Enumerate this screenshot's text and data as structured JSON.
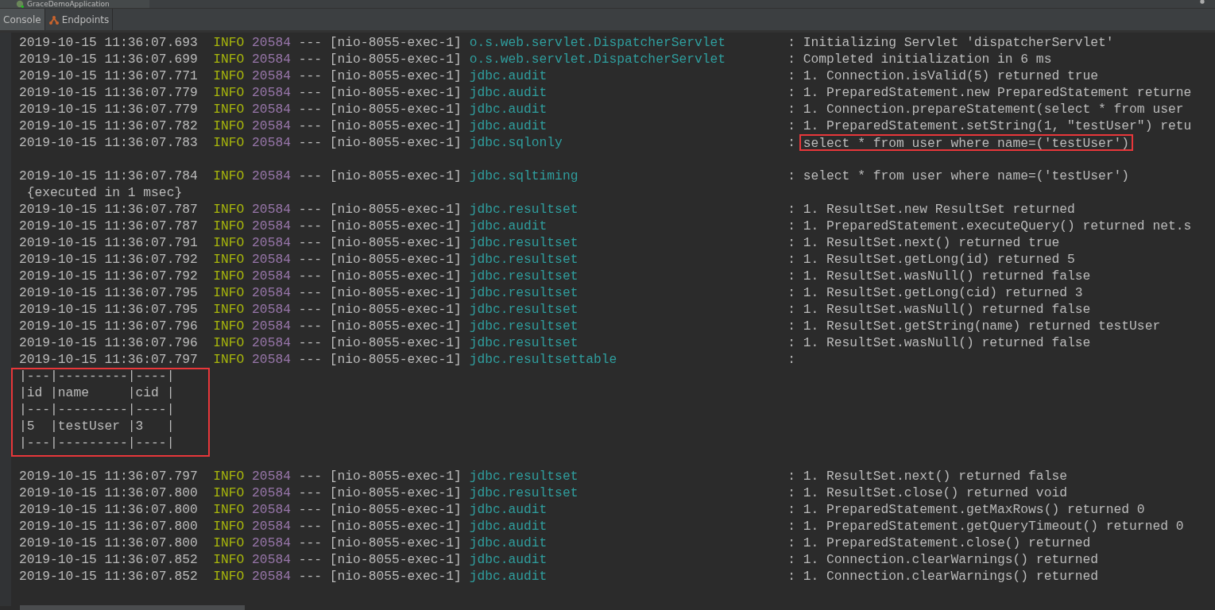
{
  "window": {
    "title": "GraceDemoApplication"
  },
  "tabs": [
    {
      "label": "Console",
      "selected": true
    },
    {
      "label": "Endpoints",
      "selected": false
    }
  ],
  "rows": [
    {
      "kind": "log",
      "time": "2019-10-15 11:36:07.693",
      "level": "INFO",
      "pid": "20584",
      "dashes": "---",
      "thread": "[nio-8055-exec-1]",
      "logger": "o.s.web.servlet.DispatcherServlet",
      "sep": ":",
      "message": "Initializing Servlet 'dispatcherServlet'"
    },
    {
      "kind": "log",
      "time": "2019-10-15 11:36:07.699",
      "level": "INFO",
      "pid": "20584",
      "dashes": "---",
      "thread": "[nio-8055-exec-1]",
      "logger": "o.s.web.servlet.DispatcherServlet",
      "sep": ":",
      "message": "Completed initialization in 6 ms"
    },
    {
      "kind": "log",
      "time": "2019-10-15 11:36:07.771",
      "level": "INFO",
      "pid": "20584",
      "dashes": "---",
      "thread": "[nio-8055-exec-1]",
      "logger": "jdbc.audit",
      "sep": ":",
      "message": "1. Connection.isValid(5) returned true"
    },
    {
      "kind": "log",
      "time": "2019-10-15 11:36:07.779",
      "level": "INFO",
      "pid": "20584",
      "dashes": "---",
      "thread": "[nio-8055-exec-1]",
      "logger": "jdbc.audit",
      "sep": ":",
      "message": "1. PreparedStatement.new PreparedStatement returne"
    },
    {
      "kind": "log",
      "time": "2019-10-15 11:36:07.779",
      "level": "INFO",
      "pid": "20584",
      "dashes": "---",
      "thread": "[nio-8055-exec-1]",
      "logger": "jdbc.audit",
      "sep": ":",
      "message": "1. Connection.prepareStatement(select * from user"
    },
    {
      "kind": "log",
      "time": "2019-10-15 11:36:07.782",
      "level": "INFO",
      "pid": "20584",
      "dashes": "---",
      "thread": "[nio-8055-exec-1]",
      "logger": "jdbc.audit",
      "sep": ":",
      "message": "1. PreparedStatement.setString(1, \"testUser\") retu"
    },
    {
      "kind": "log",
      "time": "2019-10-15 11:36:07.783",
      "level": "INFO",
      "pid": "20584",
      "dashes": "---",
      "thread": "[nio-8055-exec-1]",
      "logger": "jdbc.sqlonly",
      "sep": ":",
      "message": "select * from user where name=('testUser')",
      "highlighted": true
    },
    {
      "kind": "blank"
    },
    {
      "kind": "log",
      "time": "2019-10-15 11:36:07.784",
      "level": "INFO",
      "pid": "20584",
      "dashes": "---",
      "thread": "[nio-8055-exec-1]",
      "logger": "jdbc.sqltiming",
      "sep": ":",
      "message": "select * from user where name=('testUser')"
    },
    {
      "kind": "text",
      "text": " {executed in 1 msec}"
    },
    {
      "kind": "log",
      "time": "2019-10-15 11:36:07.787",
      "level": "INFO",
      "pid": "20584",
      "dashes": "---",
      "thread": "[nio-8055-exec-1]",
      "logger": "jdbc.resultset",
      "sep": ":",
      "message": "1. ResultSet.new ResultSet returned"
    },
    {
      "kind": "log",
      "time": "2019-10-15 11:36:07.787",
      "level": "INFO",
      "pid": "20584",
      "dashes": "---",
      "thread": "[nio-8055-exec-1]",
      "logger": "jdbc.audit",
      "sep": ":",
      "message": "1. PreparedStatement.executeQuery() returned net.s"
    },
    {
      "kind": "log",
      "time": "2019-10-15 11:36:07.791",
      "level": "INFO",
      "pid": "20584",
      "dashes": "---",
      "thread": "[nio-8055-exec-1]",
      "logger": "jdbc.resultset",
      "sep": ":",
      "message": "1. ResultSet.next() returned true"
    },
    {
      "kind": "log",
      "time": "2019-10-15 11:36:07.792",
      "level": "INFO",
      "pid": "20584",
      "dashes": "---",
      "thread": "[nio-8055-exec-1]",
      "logger": "jdbc.resultset",
      "sep": ":",
      "message": "1. ResultSet.getLong(id) returned 5"
    },
    {
      "kind": "log",
      "time": "2019-10-15 11:36:07.792",
      "level": "INFO",
      "pid": "20584",
      "dashes": "---",
      "thread": "[nio-8055-exec-1]",
      "logger": "jdbc.resultset",
      "sep": ":",
      "message": "1. ResultSet.wasNull() returned false"
    },
    {
      "kind": "log",
      "time": "2019-10-15 11:36:07.795",
      "level": "INFO",
      "pid": "20584",
      "dashes": "---",
      "thread": "[nio-8055-exec-1]",
      "logger": "jdbc.resultset",
      "sep": ":",
      "message": "1. ResultSet.getLong(cid) returned 3"
    },
    {
      "kind": "log",
      "time": "2019-10-15 11:36:07.795",
      "level": "INFO",
      "pid": "20584",
      "dashes": "---",
      "thread": "[nio-8055-exec-1]",
      "logger": "jdbc.resultset",
      "sep": ":",
      "message": "1. ResultSet.wasNull() returned false"
    },
    {
      "kind": "log",
      "time": "2019-10-15 11:36:07.796",
      "level": "INFO",
      "pid": "20584",
      "dashes": "---",
      "thread": "[nio-8055-exec-1]",
      "logger": "jdbc.resultset",
      "sep": ":",
      "message": "1. ResultSet.getString(name) returned testUser"
    },
    {
      "kind": "log",
      "time": "2019-10-15 11:36:07.796",
      "level": "INFO",
      "pid": "20584",
      "dashes": "---",
      "thread": "[nio-8055-exec-1]",
      "logger": "jdbc.resultset",
      "sep": ":",
      "message": "1. ResultSet.wasNull() returned false"
    },
    {
      "kind": "log",
      "time": "2019-10-15 11:36:07.797",
      "level": "INFO",
      "pid": "20584",
      "dashes": "---",
      "thread": "[nio-8055-exec-1]",
      "logger": "jdbc.resultsettable",
      "sep": ":"
    },
    {
      "kind": "table",
      "highlighted": true,
      "lines": [
        "|---|---------|----|",
        "|id |name     |cid |",
        "|---|---------|----|",
        "|5  |testUser |3   |",
        "|---|---------|----|"
      ]
    },
    {
      "kind": "blank"
    },
    {
      "kind": "log",
      "time": "2019-10-15 11:36:07.797",
      "level": "INFO",
      "pid": "20584",
      "dashes": "---",
      "thread": "[nio-8055-exec-1]",
      "logger": "jdbc.resultset",
      "sep": ":",
      "message": "1. ResultSet.next() returned false"
    },
    {
      "kind": "log",
      "time": "2019-10-15 11:36:07.800",
      "level": "INFO",
      "pid": "20584",
      "dashes": "---",
      "thread": "[nio-8055-exec-1]",
      "logger": "jdbc.resultset",
      "sep": ":",
      "message": "1. ResultSet.close() returned void"
    },
    {
      "kind": "log",
      "time": "2019-10-15 11:36:07.800",
      "level": "INFO",
      "pid": "20584",
      "dashes": "---",
      "thread": "[nio-8055-exec-1]",
      "logger": "jdbc.audit",
      "sep": ":",
      "message": "1. PreparedStatement.getMaxRows() returned 0"
    },
    {
      "kind": "log",
      "time": "2019-10-15 11:36:07.800",
      "level": "INFO",
      "pid": "20584",
      "dashes": "---",
      "thread": "[nio-8055-exec-1]",
      "logger": "jdbc.audit",
      "sep": ":",
      "message": "1. PreparedStatement.getQueryTimeout() returned 0"
    },
    {
      "kind": "log",
      "time": "2019-10-15 11:36:07.800",
      "level": "INFO",
      "pid": "20584",
      "dashes": "---",
      "thread": "[nio-8055-exec-1]",
      "logger": "jdbc.audit",
      "sep": ":",
      "message": "1. PreparedStatement.close() returned"
    },
    {
      "kind": "log",
      "time": "2019-10-15 11:36:07.852",
      "level": "INFO",
      "pid": "20584",
      "dashes": "---",
      "thread": "[nio-8055-exec-1]",
      "logger": "jdbc.audit",
      "sep": ":",
      "message": "1. Connection.clearWarnings() returned"
    },
    {
      "kind": "log",
      "time": "2019-10-15 11:36:07.852",
      "level": "INFO",
      "pid": "20584",
      "dashes": "---",
      "thread": "[nio-8055-exec-1]",
      "logger": "jdbc.audit",
      "sep": ":",
      "message": "1. Connection.clearWarnings() returned"
    }
  ]
}
